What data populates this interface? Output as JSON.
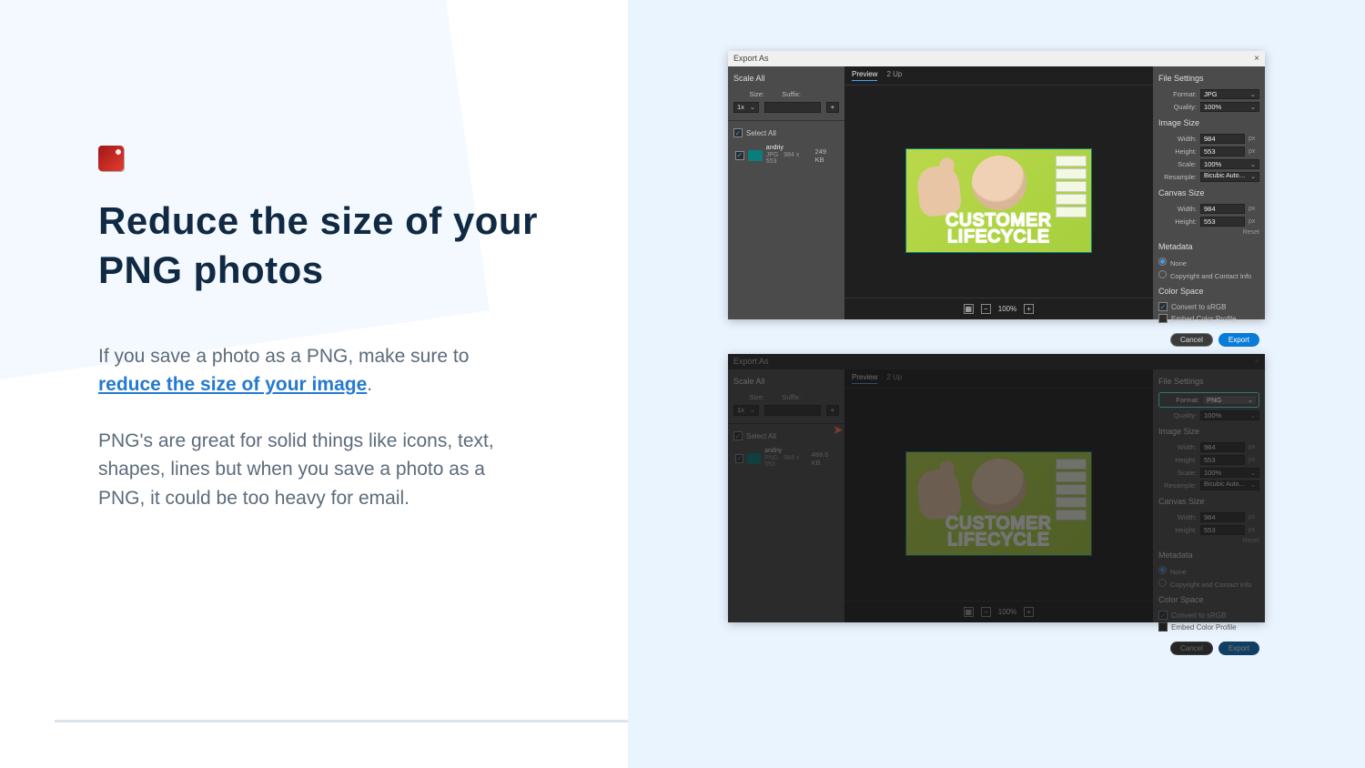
{
  "icon": "siren-icon",
  "heading": "Reduce the size of your PNG photos",
  "p1_pre": "If you save a photo as a PNG, make sure to ",
  "p1_link": "reduce the size of your image",
  "p1_post": ".",
  "p2": "PNG's are great for solid things like icons, text, shapes, lines but when you save a photo as a PNG, it could be too heavy for email.",
  "dialog": {
    "title": "Export As",
    "close": "×",
    "scaleAll": "Scale All",
    "sizeLbl": "Size:",
    "suffixLbl": "Suffix:",
    "sizeVal": "1x",
    "plus": "+",
    "selectAll": "Select All",
    "asset": {
      "name": "andriy",
      "dims": "984 x 553"
    },
    "tabs": {
      "preview": "Preview",
      "twoup": "2 Up"
    },
    "previewText1": "CUSTOMER",
    "previewText2": "LIFECYCLE",
    "zoom": "100%",
    "settings": {
      "fileSettings": "File Settings",
      "formatLbl": "Format:",
      "qualityLbl": "Quality:",
      "qualityVal": "100%",
      "imageSize": "Image Size",
      "widthLbl": "Width:",
      "widthVal": "984",
      "heightLbl": "Height:",
      "heightVal": "553",
      "px": "px",
      "scaleLbl": "Scale:",
      "scaleVal": "100%",
      "resampleLbl": "Resample:",
      "resampleVal": "Bicubic Auto…",
      "canvasSize": "Canvas Size",
      "reset": "Reset",
      "metadata": "Metadata",
      "metaNone": "None",
      "metaCopy": "Copyright and Contact Info",
      "colorSpace": "Color Space",
      "srgb": "Convert to sRGB",
      "embed": "Embed Color Profile",
      "cancel": "Cancel",
      "export": "Export"
    }
  },
  "top": {
    "ext": "JPG",
    "format": "JPG",
    "size": "249 KB"
  },
  "bottom": {
    "ext": "PNG",
    "format": "PNG",
    "size": "488.6 KB"
  }
}
